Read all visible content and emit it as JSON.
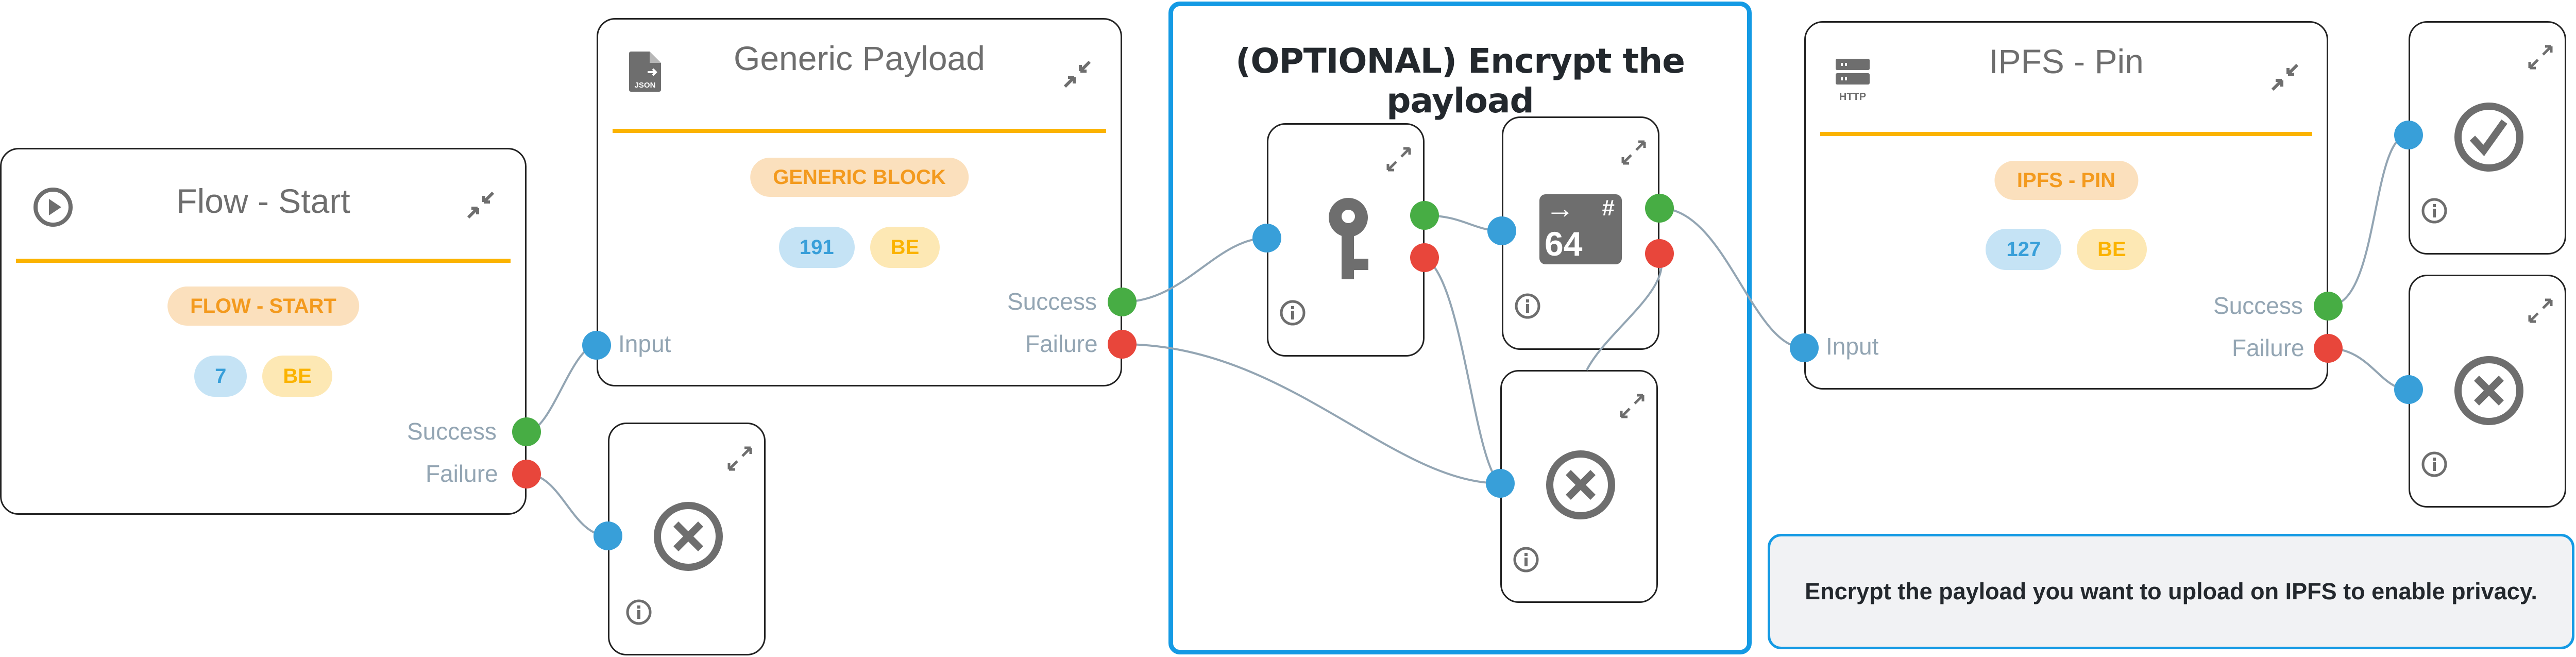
{
  "nodes": {
    "flow_start": {
      "title": "Flow - Start",
      "type_badge": "FLOW - START",
      "id_badge": "7",
      "tag_badge": "BE",
      "icon": "play-circle-icon",
      "outputs": [
        "Success",
        "Failure"
      ]
    },
    "generic_payload": {
      "title": "Generic Payload",
      "type_badge": "GENERIC BLOCK",
      "id_badge": "191",
      "tag_badge": "BE",
      "icon": "json-file-icon",
      "input": "Input",
      "outputs": [
        "Success",
        "Failure"
      ]
    },
    "ipfs_pin": {
      "title": "IPFS - Pin",
      "type_badge": "IPFS - PIN",
      "id_badge": "127",
      "tag_badge": "BE",
      "icon": "http-server-icon",
      "icon_text": "HTTP",
      "input": "Input",
      "outputs": [
        "Success",
        "Failure"
      ]
    },
    "encrypt_key": {
      "icon": "key-icon"
    },
    "base64": {
      "icon": "base64-encode-icon",
      "icon_number": "64",
      "icon_symbol": "#",
      "icon_arrow": "→"
    },
    "error_1": {
      "icon": "error-circle-icon"
    },
    "error_2": {
      "icon": "error-circle-icon"
    },
    "error_3": {
      "icon": "error-circle-icon"
    },
    "success_end": {
      "icon": "check-circle-icon"
    }
  },
  "group": {
    "title": "(OPTIONAL) Encrypt the payload"
  },
  "note": {
    "text": "Encrypt the payload you want to upload on IPFS to enable privacy."
  },
  "colors": {
    "accent_divider": "#fbb300",
    "group_border": "#149ae4",
    "port_input": "#389fd9",
    "port_success": "#47ad44",
    "port_failure": "#e8463b",
    "wire": "#93a5b3"
  }
}
